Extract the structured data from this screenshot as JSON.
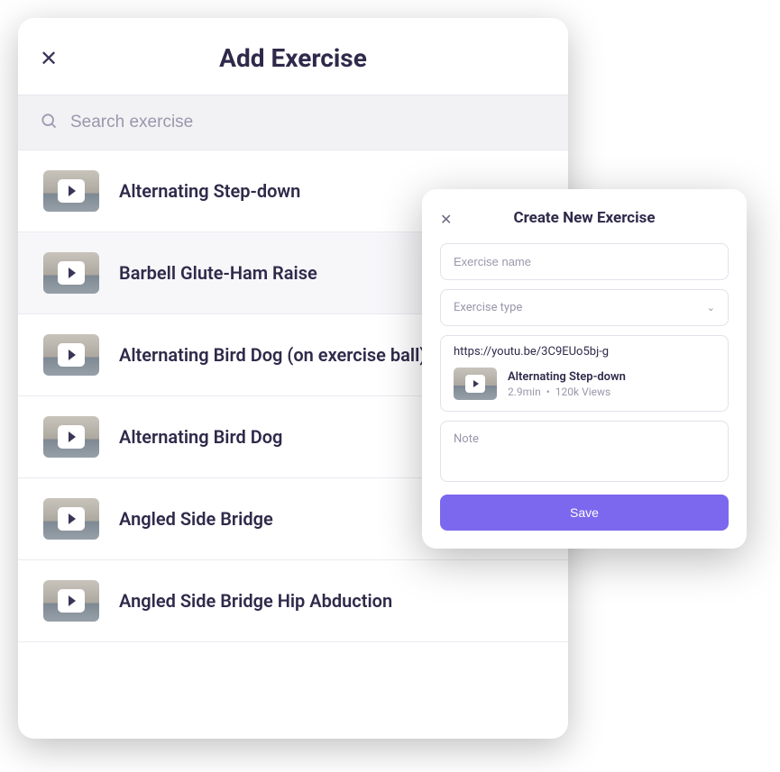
{
  "main": {
    "title": "Add Exercise",
    "search_placeholder": "Search exercise",
    "items": [
      {
        "label": "Alternating Step-down"
      },
      {
        "label": "Barbell Glute-Ham Raise"
      },
      {
        "label": "Alternating Bird Dog (on exercise ball)"
      },
      {
        "label": "Alternating Bird Dog"
      },
      {
        "label": "Angled Side Bridge"
      },
      {
        "label": "Angled Side Bridge Hip Abduction"
      }
    ]
  },
  "modal": {
    "title": "Create New Exercise",
    "name_placeholder": "Exercise name",
    "type_placeholder": "Exercise type",
    "url_value": "https://youtu.be/3C9EUo5bj-g",
    "preview": {
      "title": "Alternating Step-down",
      "duration": "2.9min",
      "views": "120k Views"
    },
    "note_placeholder": "Note",
    "save_label": "Save"
  }
}
